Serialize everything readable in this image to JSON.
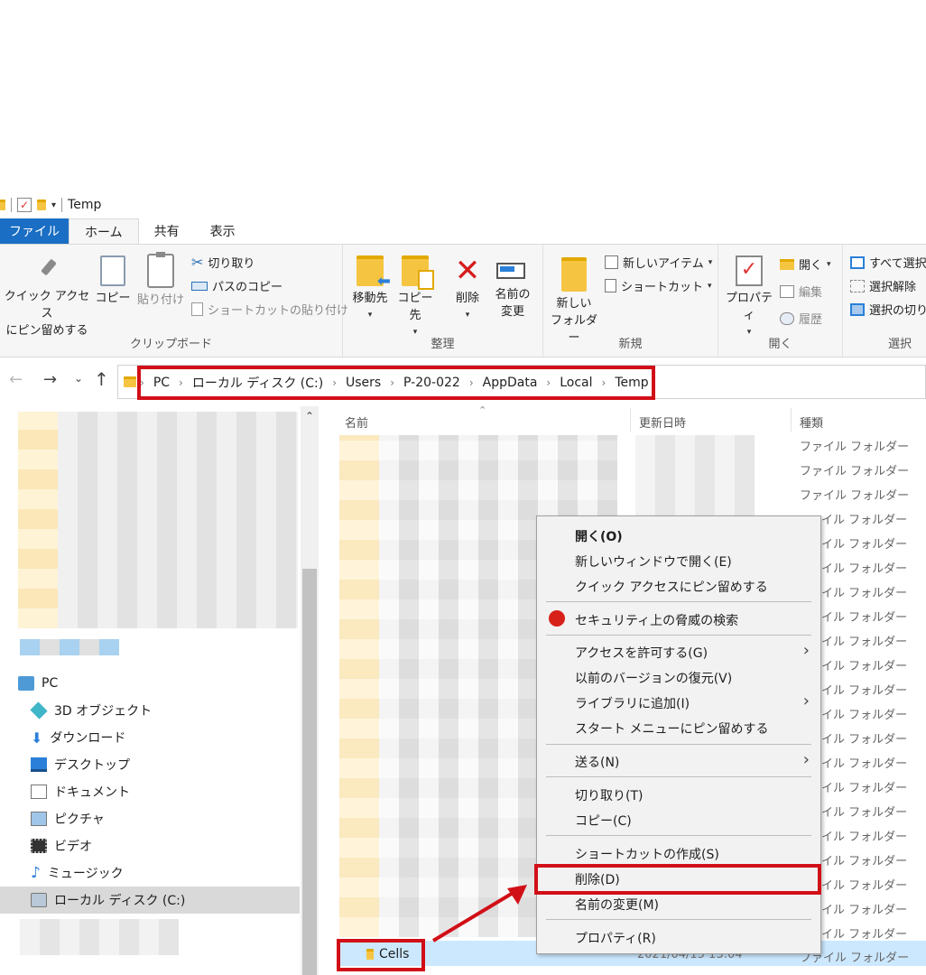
{
  "window": {
    "title": "Temp"
  },
  "tabs": {
    "file": "ファイル",
    "home": "ホーム",
    "share": "共有",
    "view": "表示"
  },
  "ribbon": {
    "clipboard": {
      "pin_line1": "クイック アクセス",
      "pin_line2": "にピン留めする",
      "copy": "コピー",
      "paste": "貼り付け",
      "cut": "切り取り",
      "copy_path": "パスのコピー",
      "paste_shortcut": "ショートカットの貼り付け",
      "label": "クリップボード"
    },
    "organize": {
      "move_to": "移動先",
      "copy_to": "コピー先",
      "delete": "削除",
      "rename_line1": "名前の",
      "rename_line2": "変更",
      "label": "整理"
    },
    "new": {
      "new_folder_line1": "新しい",
      "new_folder_line2": "フォルダー",
      "new_item": "新しいアイテム",
      "easy_access": "ショートカット",
      "label": "新規"
    },
    "open": {
      "properties": "プロパティ",
      "open": "開く",
      "edit": "編集",
      "history": "履歴",
      "label": "開く"
    },
    "select": {
      "select_all": "すべて選択",
      "select_none": "選択解除",
      "invert": "選択の切り",
      "label": "選択"
    }
  },
  "address": {
    "crumbs": [
      "PC",
      "ローカル ディスク (C:)",
      "Users",
      "P-20-022",
      "AppData",
      "Local",
      "Temp"
    ]
  },
  "navpane": {
    "items": [
      {
        "label": "PC",
        "icon": "pc-icon"
      },
      {
        "label": "3D オブジェクト",
        "icon": "3d-objects-icon"
      },
      {
        "label": "ダウンロード",
        "icon": "download-icon"
      },
      {
        "label": "デスクトップ",
        "icon": "desktop-icon"
      },
      {
        "label": "ドキュメント",
        "icon": "documents-icon"
      },
      {
        "label": "ピクチャ",
        "icon": "pictures-icon"
      },
      {
        "label": "ビデオ",
        "icon": "videos-icon"
      },
      {
        "label": "ミュージック",
        "icon": "music-icon"
      },
      {
        "label": "ローカル ディスク (C:)",
        "icon": "local-disk-icon"
      }
    ]
  },
  "filelist": {
    "columns": {
      "name": "名前",
      "modified": "更新日時",
      "type": "種類"
    },
    "folder_type": "ファイル フォルダー",
    "partial_type": "イル フォルダー",
    "selected_row": {
      "name": "Cells",
      "modified": "2021/04/15 13:04",
      "type": "ファイル フォルダー"
    }
  },
  "context_menu": {
    "items": [
      {
        "label": "開く(O)",
        "bold": true
      },
      {
        "label": "新しいウィンドウで開く(E)"
      },
      {
        "label": "クイック アクセスにピン留めする"
      },
      {
        "label": "セキュリティ上の脅威の検索"
      },
      {
        "label": "アクセスを許可する(G)",
        "submenu": true
      },
      {
        "label": "以前のバージョンの復元(V)"
      },
      {
        "label": "ライブラリに追加(I)",
        "submenu": true
      },
      {
        "label": "スタート メニューにピン留めする"
      },
      {
        "label": "送る(N)",
        "submenu": true
      },
      {
        "label": "切り取り(T)"
      },
      {
        "label": "コピー(C)"
      },
      {
        "label": "ショートカットの作成(S)"
      },
      {
        "label": "削除(D)",
        "highlighted": true
      },
      {
        "label": "名前の変更(M)"
      },
      {
        "label": "プロパティ(R)"
      }
    ]
  },
  "colors": {
    "accent": "#1a6ec3",
    "highlight_box": "#d10f17",
    "selection": "#cce8ff"
  }
}
